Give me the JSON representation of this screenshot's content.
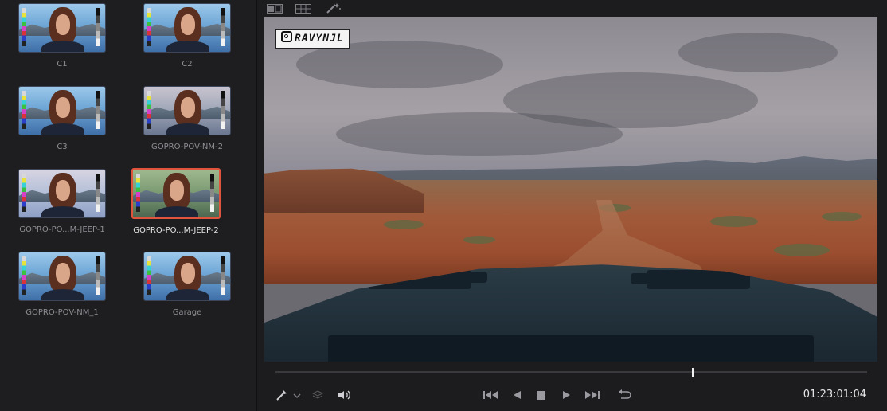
{
  "gallery": {
    "stills": [
      {
        "label": "C1",
        "tint": "blue",
        "selected": false
      },
      {
        "label": "C2",
        "tint": "blue",
        "selected": false
      },
      {
        "label": "C3",
        "tint": "blue",
        "selected": false
      },
      {
        "label": "GOPRO-POV-NM-2",
        "tint": "warm",
        "selected": false
      },
      {
        "label": "GOPRO-PO...M-JEEP-1",
        "tint": "bright",
        "selected": false
      },
      {
        "label": "GOPRO-PO...M-JEEP-2",
        "tint": "green",
        "selected": true
      },
      {
        "label": "GOPRO-POV-NM_1",
        "tint": "blue",
        "selected": false
      },
      {
        "label": "Garage",
        "tint": "blue",
        "selected": false
      }
    ]
  },
  "viewer": {
    "watermark": "RAVYNJL",
    "toolbar_icons": [
      "split-screen-icon",
      "grid-icon",
      "magic-wand-icon"
    ]
  },
  "transport": {
    "timecode": "01:23:01:04",
    "playhead_fraction": 0.705,
    "controls": [
      "first-frame",
      "reverse-play",
      "stop",
      "play",
      "last-frame",
      "loop"
    ],
    "left_tools": [
      "color-picker",
      "layers",
      "audio"
    ]
  },
  "colors": {
    "selected_border": "#e0533d",
    "panel_bg": "#1c1c1e"
  }
}
